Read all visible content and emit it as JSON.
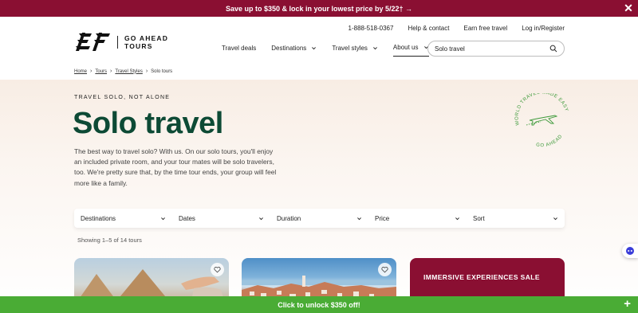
{
  "promo": {
    "text": "Save up to $350 & lock in your lowest price by 5/22† →",
    "close_icon": "close-icon"
  },
  "utility_nav": {
    "phone": "1-888-518-0367",
    "help": "Help & contact",
    "earn": "Earn free travel",
    "login": "Log in/Register"
  },
  "logo": {
    "brand_line1": "GO AHEAD",
    "brand_line2": "TOURS"
  },
  "main_nav": {
    "items": [
      {
        "label": "Travel deals",
        "has_dropdown": false
      },
      {
        "label": "Destinations",
        "has_dropdown": true
      },
      {
        "label": "Travel styles",
        "has_dropdown": true
      },
      {
        "label": "About us",
        "has_dropdown": true
      }
    ]
  },
  "search": {
    "value": "Solo travel",
    "icon": "search-icon"
  },
  "breadcrumb": {
    "items": [
      "Home",
      "Tours",
      "Travel Styles",
      "Solo tours"
    ]
  },
  "hero": {
    "eyebrow": "TRAVEL SOLO, NOT ALONE",
    "title": "Solo travel",
    "intro": "The best way to travel solo? With us. On our solo tours, you'll enjoy an included private room, and your tour mates will be solo travelers, too. We're pretty sure that, by the time tour ends, your group will feel more like a family.",
    "badge_text_top": "WORLD TRAVEL MADE EASY",
    "badge_text_bottom": "GO AHEAD"
  },
  "filters": {
    "items": [
      "Destinations",
      "Dates",
      "Duration",
      "Price",
      "Sort"
    ]
  },
  "results": {
    "count_text": "Showing 1–5 of 14 tours"
  },
  "cards": {
    "third_title": "IMMERSIVE EXPERIENCES SALE"
  },
  "bottom_bar": {
    "text": "Click to unlock $350 off!"
  },
  "colors": {
    "promo_bg": "#8a0f32",
    "title_green": "#0d4a35",
    "cta_green": "#4aac35",
    "badge_green": "#3d9a3a"
  }
}
